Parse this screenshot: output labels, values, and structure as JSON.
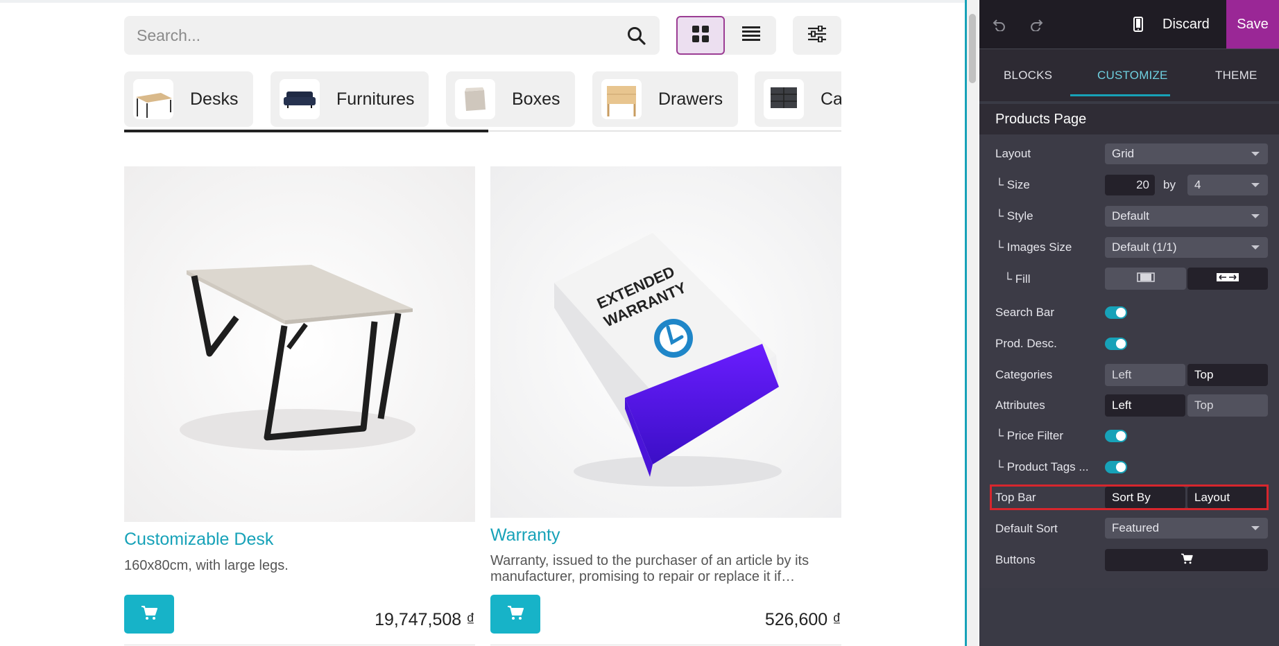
{
  "search": {
    "placeholder": "Search..."
  },
  "categories": [
    {
      "label": "Desks"
    },
    {
      "label": "Furnitures"
    },
    {
      "label": "Boxes"
    },
    {
      "label": "Drawers"
    },
    {
      "label": "Ca"
    }
  ],
  "products": [
    {
      "title": "Customizable Desk",
      "description": "160x80cm, with large legs.",
      "price": "19,747,508 ₫"
    },
    {
      "title": "Warranty",
      "description": "Warranty, issued to the purchaser of an article by its manufacturer, promising to repair or replace it if…",
      "price": "526,600 ₫",
      "image_text": [
        "EXTENDED",
        "WARRANTY"
      ]
    }
  ],
  "editor": {
    "discard_label": "Discard",
    "save_label": "Save",
    "tabs": [
      {
        "label": "BLOCKS"
      },
      {
        "label": "CUSTOMIZE",
        "active": true
      },
      {
        "label": "THEME"
      }
    ],
    "section_title": "Products Page",
    "rows": {
      "layout": {
        "label": "Layout",
        "value": "Grid"
      },
      "size": {
        "label": "└ Size",
        "value": "20",
        "by": "by",
        "per_row": "4"
      },
      "style": {
        "label": "└ Style",
        "value": "Default"
      },
      "images_size": {
        "label": "└ Images Size",
        "value": "Default (1/1)"
      },
      "fill": {
        "label": "└ Fill"
      },
      "search_bar": {
        "label": "Search Bar",
        "enabled": true
      },
      "prod_desc": {
        "label": "Prod. Desc.",
        "enabled": true
      },
      "categories": {
        "label": "Categories",
        "options": [
          "Left",
          "Top"
        ],
        "selected": "Top"
      },
      "attributes": {
        "label": "Attributes",
        "options": [
          "Left",
          "Top"
        ],
        "selected": "Left"
      },
      "price_filter": {
        "label": "└ Price Filter",
        "enabled": true
      },
      "product_tags": {
        "label": "└ Product Tags ...",
        "enabled": true
      },
      "top_bar": {
        "label": "Top Bar",
        "options": [
          "Sort By",
          "Layout"
        ],
        "selected": [
          "Sort By",
          "Layout"
        ]
      },
      "default_sort": {
        "label": "Default Sort",
        "value": "Featured"
      },
      "buttons": {
        "label": "Buttons"
      }
    }
  },
  "colors": {
    "accent": "#17a2b8",
    "brand": "#9a2796",
    "highlight": "#d7262d",
    "panel_bg": "#3c3b46"
  }
}
